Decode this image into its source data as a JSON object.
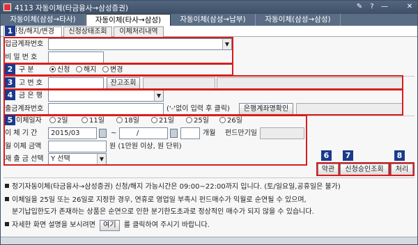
{
  "window": {
    "title": "4113 자동이체(타금융사→삼성증권)",
    "btn_pin": "✎",
    "btn_help": "?",
    "btn_min": "—",
    "btn_close": "✕"
  },
  "main_tabs": [
    "자동이체(삼성→타사)",
    "자동이체(타사→삼성)",
    "자동이체(삼성→납부)",
    "자동이체(삼성→삼성)"
  ],
  "sub_tabs": [
    "신청/해지/변경",
    "신청상태조회",
    "이체처리내역"
  ],
  "badges": [
    "1",
    "2",
    "3",
    "4",
    "5",
    "6",
    "7",
    "8"
  ],
  "form": {
    "deposit_account_label": "입금계좌번호",
    "password_label": "비 밀 번 호",
    "category_label": "구 분",
    "category_options": [
      "신청",
      "해지",
      "변경"
    ],
    "balance_label": "고 번 호",
    "balance_btn": "잔고조회",
    "bank_label": "금 은 행",
    "withdraw_label": "출금계좌번호",
    "withdraw_hint": "('-'없이 입력 후 클릭)",
    "owner_check_btn": "은행계좌명확인",
    "date_label": "이체일자",
    "date_options": [
      "2일",
      "11일",
      "18일",
      "21일",
      "25일",
      "26일"
    ],
    "period_label": "이 체 기 간",
    "period_from": "2015/03",
    "period_sep": "~",
    "period_to": "/",
    "months_label": "개월",
    "fund_maturity_label": "펀드만기일",
    "monthly_amount_label": "월 이체 금액",
    "monthly_amount_unit": "원 (1만원 이상, 원 단위)",
    "retry_label": "재 출 금 선택",
    "retry_value": "Y 선택"
  },
  "actions": {
    "terms": "약관",
    "approval": "신청승인조회",
    "process": "처리"
  },
  "notes": {
    "n1": "정기자동이체(타금융사→삼성증권) 신청/해지 가능시간은 09:00~22:00까지 입니다. (토/일요일,공휴일은 불가)",
    "n2": "이체일을 25일 또는 26일로 지정한 경우, 연휴로 영업일 부족시 펀드매수가 익월로 순연될 수 있으며,",
    "n3": "분기납입한도가 존재하는 상품은 순연으로 인한 분기한도초과로 정상적인 매수가 되지 않을 수 있습니다.",
    "n4_pre": "자세한 화면 설명을 보시려면",
    "n4_btn": "여기",
    "n4_post": "를 클릭하여 주시기 바랍니다."
  },
  "colors": {
    "highlight": "#d91c1c",
    "badge": "#1b3a8c",
    "titlebar": "#3e5068"
  }
}
